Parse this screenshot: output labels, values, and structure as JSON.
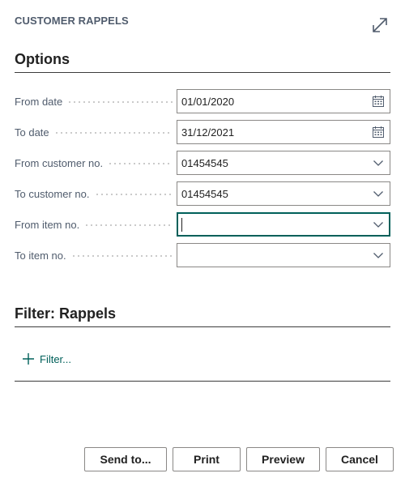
{
  "dialog": {
    "title": "CUSTOMER RAPPELS"
  },
  "options": {
    "heading": "Options",
    "fields": [
      {
        "label": "From date",
        "value": "01/01/2020",
        "icon": "calendar-icon"
      },
      {
        "label": "To date",
        "value": "31/12/2021",
        "icon": "calendar-icon"
      },
      {
        "label": "From customer no.",
        "value": "01454545",
        "icon": "chevron-down-icon"
      },
      {
        "label": "To customer no.",
        "value": "01454545",
        "icon": "chevron-down-icon"
      },
      {
        "label": "From item no.",
        "value": "",
        "icon": "chevron-down-icon"
      },
      {
        "label": "To item no.",
        "value": "",
        "icon": "chevron-down-icon"
      }
    ]
  },
  "filter": {
    "heading": "Filter: Rappels",
    "add_label": "Filter..."
  },
  "buttons": {
    "send_to": "Send to...",
    "print": "Print",
    "preview": "Preview",
    "cancel": "Cancel"
  },
  "colors": {
    "accent": "#00605a",
    "label": "#505c6d",
    "rule": "#3c3c3c",
    "border": "#8a8886"
  }
}
